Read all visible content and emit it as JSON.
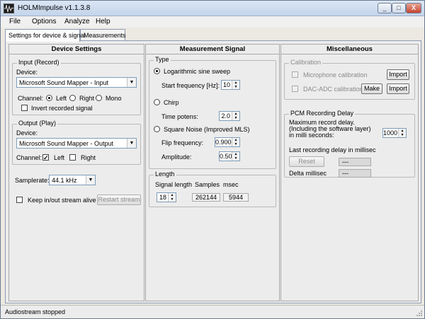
{
  "window": {
    "title": "HOLMImpulse  v1.1.3.8",
    "minimize": "_",
    "maximize": "□",
    "close": "X"
  },
  "menu": [
    "File",
    "Options",
    "Analyze",
    "Help"
  ],
  "tabs": [
    "Settings for device & signal",
    "Measurements"
  ],
  "device_settings": {
    "heading": "Device Settings",
    "input": {
      "title": "Input (Record)",
      "device_label": "Device:",
      "device_value": "Microsoft Sound Mapper - Input",
      "channel_label": "Channel:",
      "left": "Left",
      "right": "Right",
      "mono": "Mono",
      "invert": "Invert recorded signal"
    },
    "output": {
      "title": "Output (Play)",
      "device_label": "Device:",
      "device_value": "Microsoft Sound Mapper - Output",
      "channel_label": "Channel:",
      "left": "Left",
      "right": "Right"
    },
    "samplerate_label": "Samplerate:",
    "samplerate_value": "44.1 kHz",
    "keep_alive": "Keep in/out stream alive",
    "restart": "Restart stream"
  },
  "measurement_signal": {
    "heading": "Measurement Signal",
    "type_title": "Type",
    "log_sweep": "Logarithmic sine sweep",
    "start_freq_label": "Start frequency [Hz]:",
    "start_freq_value": "10",
    "chirp": "Chirp",
    "time_potens_label": "Time potens:",
    "time_potens_value": "2.0",
    "square_noise": "Square Noise (Improved MLS)",
    "flip_freq_label": "Flip frequency:",
    "flip_freq_value": "0.900",
    "amplitude_label": "Amplitude:",
    "amplitude_value": "0.50",
    "length_title": "Length",
    "signal_length_label": "Signal length",
    "samples_label": "Samples",
    "msec_label": "msec",
    "signal_length_value": "18",
    "samples_value": "262144",
    "msec_value": "5944"
  },
  "misc": {
    "heading": "Miscellaneous",
    "calibration_title": "Calibration",
    "mic_cal": "Microphone calibration",
    "dac_cal": "DAC-ADC calibration",
    "import": "Import",
    "make": "Make",
    "pcm_title": "PCM Recording Delay",
    "max_delay_1": "Maximum record delay.",
    "max_delay_2": "(Including the software layer)",
    "max_delay_3": "in milli seconds:",
    "max_delay_value": "1000",
    "last_delay": "Last recording delay in millisec",
    "reset": "Reset",
    "last_delay_value": "---",
    "delta_label": "Delta millisec",
    "delta_value": "---"
  },
  "status": {
    "text": "Audiostream stopped"
  },
  "colors": {
    "titlebar": "#c3d4ea",
    "panel": "#ececec",
    "close": "#c4432d"
  }
}
